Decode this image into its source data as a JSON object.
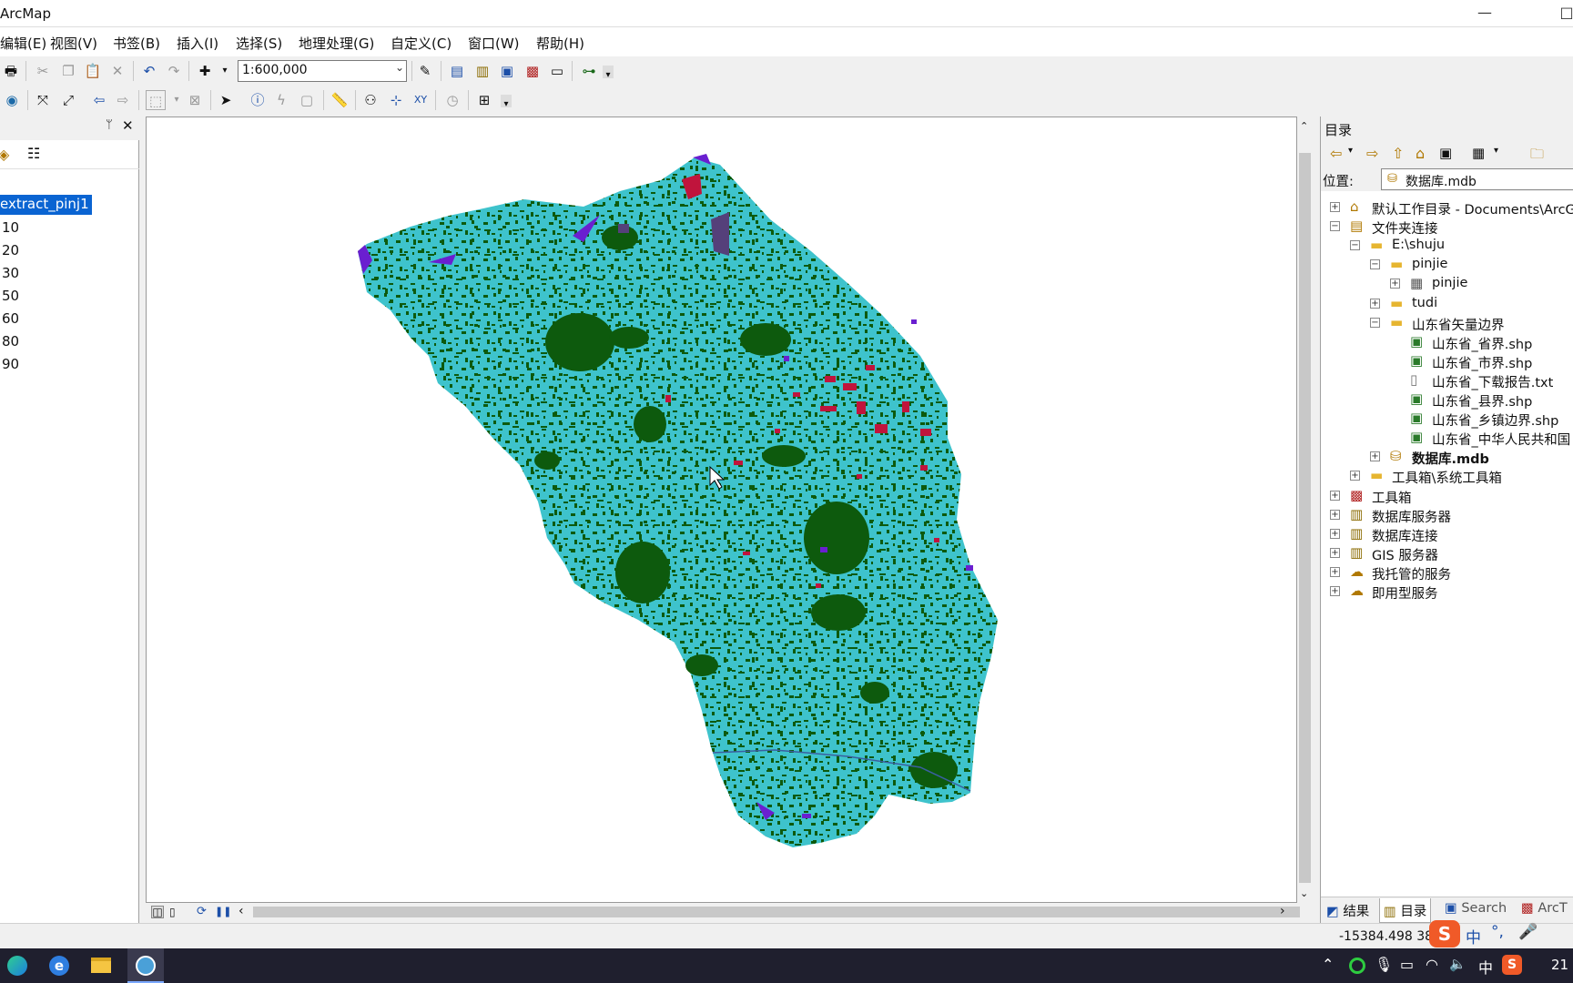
{
  "title": "ArcMap",
  "menus": [
    "编辑(E)",
    "视图(V)",
    "书签(B)",
    "插入(I)",
    "选择(S)",
    "地理处理(G)",
    "自定义(C)",
    "窗口(W)",
    "帮助(H)"
  ],
  "scale": "1:600,000",
  "toc": {
    "layer_name": "extract_pinj1",
    "classes": [
      "10",
      "20",
      "30",
      "50",
      "60",
      "80",
      "90"
    ]
  },
  "catalog": {
    "title": "目录",
    "location_label": "位置:",
    "location_value": "数据库.mdb",
    "tree": [
      {
        "label": "默认工作目录 - Documents\\ArcGIS",
        "exp": "+",
        "icon": "home",
        "indent": 0
      },
      {
        "label": "文件夹连接",
        "exp": "-",
        "icon": "folderconn",
        "indent": 0
      },
      {
        "label": "E:\\shuju",
        "exp": "-",
        "icon": "folder",
        "indent": 1
      },
      {
        "label": "pinjie",
        "exp": "-",
        "icon": "folder",
        "indent": 2
      },
      {
        "label": "pinjie",
        "exp": "+",
        "icon": "raster",
        "indent": 3
      },
      {
        "label": "tudi",
        "exp": "+",
        "icon": "folder",
        "indent": 2
      },
      {
        "label": "山东省矢量边界",
        "exp": "-",
        "icon": "folder",
        "indent": 2
      },
      {
        "label": "山东省_省界.shp",
        "exp": "",
        "icon": "shp",
        "indent": 3
      },
      {
        "label": "山东省_市界.shp",
        "exp": "",
        "icon": "shp",
        "indent": 3
      },
      {
        "label": "山东省_下载报告.txt",
        "exp": "",
        "icon": "txt",
        "indent": 3
      },
      {
        "label": "山东省_县界.shp",
        "exp": "",
        "icon": "shp",
        "indent": 3
      },
      {
        "label": "山东省_乡镇边界.shp",
        "exp": "",
        "icon": "shp",
        "indent": 3
      },
      {
        "label": "山东省_中华人民共和国",
        "exp": "",
        "icon": "shp",
        "indent": 3
      },
      {
        "label": "数据库.mdb",
        "exp": "+",
        "icon": "mdb",
        "indent": 2,
        "bold": true
      },
      {
        "label": "工具箱\\系统工具箱",
        "exp": "+",
        "icon": "folder",
        "indent": 1
      },
      {
        "label": "工具箱",
        "exp": "+",
        "icon": "toolbox",
        "indent": 0
      },
      {
        "label": "数据库服务器",
        "exp": "+",
        "icon": "db",
        "indent": 0
      },
      {
        "label": "数据库连接",
        "exp": "+",
        "icon": "db",
        "indent": 0
      },
      {
        "label": "GIS 服务器",
        "exp": "+",
        "icon": "db",
        "indent": 0
      },
      {
        "label": "我托管的服务",
        "exp": "+",
        "icon": "cloud",
        "indent": 0
      },
      {
        "label": "即用型服务",
        "exp": "+",
        "icon": "cloud",
        "indent": 0
      }
    ],
    "tabs": [
      "结果",
      "目录",
      "Search",
      "ArcT"
    ]
  },
  "status": {
    "coords": "-15384.498  38800"
  },
  "taskbar": {
    "ime1": "中",
    "ime2": "中",
    "time": "21"
  },
  "colors": {
    "land_cyan": "#3ec3cc",
    "forest_green": "#0d5a0d",
    "urban_red": "#c0143c",
    "water_purple": "#6a1fd0"
  }
}
